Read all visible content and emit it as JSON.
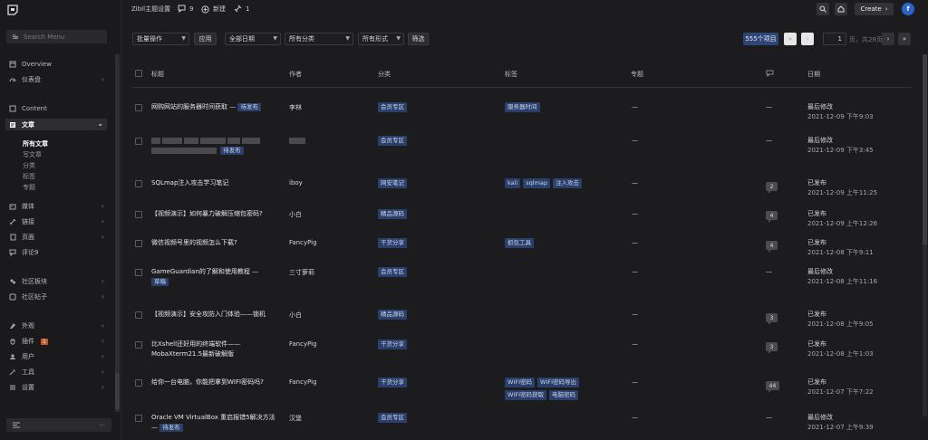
{
  "sidebar": {
    "search_placeholder": "Search Menu",
    "items": [
      {
        "label": "Overview",
        "icon": "overview-icon"
      },
      {
        "label": "仪表盘",
        "icon": "dashboard-icon"
      },
      {
        "label": "Content",
        "icon": "content-icon"
      },
      {
        "label": "文章",
        "icon": "posts-icon"
      },
      {
        "label": "媒体",
        "icon": "media-icon"
      },
      {
        "label": "链接",
        "icon": "link-icon"
      },
      {
        "label": "页面",
        "icon": "page-icon"
      },
      {
        "label": "评论9",
        "icon": "comment-icon"
      },
      {
        "label": "社区板块",
        "icon": "forum-icon"
      },
      {
        "label": "社区帖子",
        "icon": "forum-post-icon"
      },
      {
        "label": "外观",
        "icon": "appearance-icon"
      },
      {
        "label": "插件",
        "icon": "plugin-icon",
        "badge": "1"
      },
      {
        "label": "用户",
        "icon": "user-icon"
      },
      {
        "label": "工具",
        "icon": "tools-icon"
      },
      {
        "label": "设置",
        "icon": "settings-icon"
      }
    ],
    "sub_items": [
      "所有文章",
      "写文章",
      "分类",
      "标签",
      "专题"
    ],
    "bottom_more": "···"
  },
  "topbar": {
    "site_name": "Zibll主题设置",
    "comments_count": "9",
    "new_label": "新建",
    "plugin_count": "1",
    "create_label": "Create",
    "avatar_letter": "f"
  },
  "filters": {
    "bulk_action": "批量操作",
    "apply": "应用",
    "all_dates": "全部日期",
    "all_categories": "所有分类",
    "all_formats": "所有形式",
    "filter": "筛选",
    "item_count": "555个项目",
    "first": "«",
    "prev": "‹",
    "current_page": "1",
    "of_pages": "页，共28页",
    "next": "›",
    "last": "»"
  },
  "columns": {
    "title": "标题",
    "author": "作者",
    "category": "分类",
    "tags": "标签",
    "topic": "专题",
    "date": "日期"
  },
  "rows": [
    {
      "title": "网购网站的服务器时间获取 —",
      "state": "待发布",
      "author": "李林",
      "category": "会员专区",
      "tags": [
        "服务器时间"
      ],
      "topic": "—",
      "comments": "—",
      "status": "最后修改",
      "date": "2021-12-09 下午9:03"
    },
    {
      "title": "",
      "state": "待发布",
      "author": "",
      "category": "会员专区",
      "tags": [],
      "topic": "—",
      "comments": "—",
      "status": "最后修改",
      "date": "2021-12-09 下午3:45"
    },
    {
      "title": "SQLmap注入攻击学习笔记",
      "state": "",
      "author": "iboy",
      "category": "网安笔记",
      "tags": [
        "kali",
        "sqlmap",
        "注入攻击"
      ],
      "topic": "—",
      "comments": "2",
      "status": "已发布",
      "date": "2021-12-09 上午11:25"
    },
    {
      "title": "【视频演示】如何暴力破解压缩包密码?",
      "state": "",
      "author": "小白",
      "category": "精品源码",
      "tags": [],
      "topic": "—",
      "comments": "4",
      "status": "已发布",
      "date": "2021-12-09 上午12:26"
    },
    {
      "title": "微信视频号里的视频怎么下载?",
      "state": "",
      "author": "FancyPig",
      "category": "干货分享",
      "tags": [
        "抓包工具"
      ],
      "topic": "—",
      "comments": "4",
      "status": "已发布",
      "date": "2021-12-08 下午9:11"
    },
    {
      "title": "GameGuardian的了解和使用教程 —",
      "state": "草稿",
      "author": "三寸萝莉",
      "category": "会员专区",
      "tags": [],
      "topic": "—",
      "comments": "—",
      "status": "最后修改",
      "date": "2021-12-08 上午11:16"
    },
    {
      "title": "【视频演示】安全攻防入门体验——锁机",
      "state": "",
      "author": "小白",
      "category": "精品源码",
      "tags": [],
      "topic": "—",
      "comments": "3",
      "status": "已发布",
      "date": "2021-12-08 上午9:05"
    },
    {
      "title": "比Xshell还好用的终端软件——MobaXterm21.5最新破解版",
      "state": "",
      "author": "FancyPig",
      "category": "干货分享",
      "tags": [],
      "topic": "—",
      "comments": "3",
      "status": "已发布",
      "date": "2021-12-08 上午1:03"
    },
    {
      "title": "给你一台电脑，你能把拿到WIFI密码吗?",
      "state": "",
      "author": "FancyPig",
      "category": "干货分享",
      "tags": [
        "WIFI密码",
        "WIFI密码导出",
        "WIFI密码获取",
        "电脑密码"
      ],
      "topic": "—",
      "comments": "44",
      "status": "已发布",
      "date": "2021-12-07 下午7:22"
    },
    {
      "title": "Oracle VM VirtualBox 重启报错5解决方法 —",
      "state": "待发布",
      "author": "汉堡",
      "category": "会员专区",
      "tags": [],
      "topic": "—",
      "comments": "—",
      "status": "最后修改",
      "date": "2021-12-07 上午9:39"
    }
  ]
}
